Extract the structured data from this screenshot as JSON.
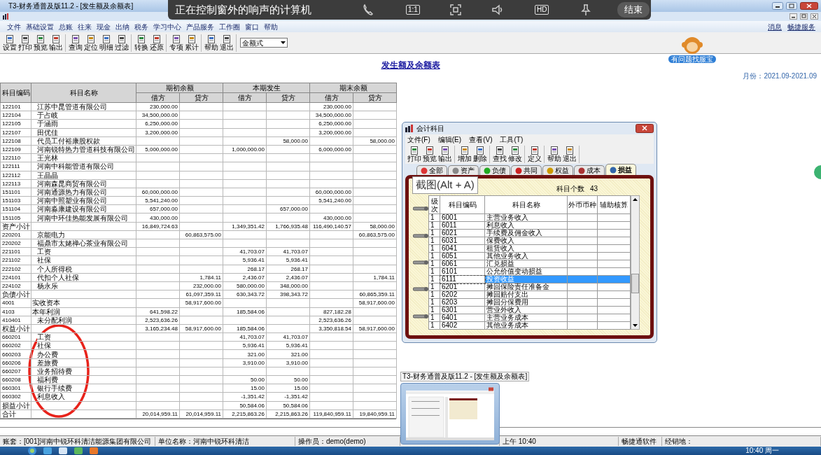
{
  "window": {
    "title": "T3-财务通普及版11.2 - [发生额及余额表]"
  },
  "share_bar": {
    "text": "正在控制窗外的响声的计算机",
    "ratio": "1:1",
    "quality": "HD",
    "end": "结束"
  },
  "menu": [
    "文件",
    "基础设置",
    "总账",
    "往来",
    "现金",
    "出纳",
    "税务",
    "学习中心",
    "产品服务",
    "工作圈",
    "窗口",
    "帮助"
  ],
  "menu_right": [
    "消息",
    "畅捷服务"
  ],
  "toolbar": [
    [
      "设置",
      "打印",
      "预览",
      "输出"
    ],
    [
      "查询",
      "定位",
      "明细",
      "过滤"
    ],
    [
      "转换",
      "还原"
    ],
    [
      "专项",
      "累计"
    ],
    [
      "帮助",
      "退出"
    ]
  ],
  "view_select": {
    "value": "金额式"
  },
  "helper": {
    "label": "有问题找服宝"
  },
  "report": {
    "title": "发生额及余额表",
    "period": "月份：2021.09-2021.09"
  },
  "table": {
    "columns": {
      "code": "科目编码",
      "name": "科目名称",
      "groups": [
        {
          "label": "期初余额",
          "debit": "借方",
          "credit": "贷方"
        },
        {
          "label": "本期发生",
          "debit": "借方",
          "credit": "贷方"
        },
        {
          "label": "期末余额",
          "debit": "借方",
          "credit": "贷方"
        }
      ]
    },
    "rows": [
      {
        "kind": "detail",
        "code": "122101",
        "name": "江苏中昆管道有限公司",
        "opening_debit": "230,000.00",
        "closing_debit": "230,000.00"
      },
      {
        "kind": "detail",
        "code": "122104",
        "name": "于占岐",
        "opening_debit": "34,500,000.00",
        "closing_debit": "34,500,000.00"
      },
      {
        "kind": "detail",
        "code": "122105",
        "name": "于涵雨",
        "opening_debit": "6,250,000.00",
        "closing_debit": "6,250,000.00"
      },
      {
        "kind": "detail",
        "code": "122107",
        "name": "田优佳",
        "opening_debit": "3,200,000.00",
        "closing_debit": "3,200,000.00"
      },
      {
        "kind": "detail",
        "code": "122108",
        "name": "代员工付裕康股权款",
        "period_credit": "58,000.00",
        "closing_credit": "58,000.00"
      },
      {
        "kind": "detail",
        "code": "122109",
        "name": "河南锐特热力管道科技有限公司",
        "opening_debit": "5,000,000.00",
        "period_debit": "1,000,000.00",
        "closing_debit": "6,000,000.00"
      },
      {
        "kind": "detail",
        "code": "122110",
        "name": "王光林"
      },
      {
        "kind": "detail",
        "code": "122111",
        "name": "河南中科能管道有限公司"
      },
      {
        "kind": "detail",
        "code": "122112",
        "name": "王晶晶"
      },
      {
        "kind": "detail",
        "code": "122113",
        "name": "河南森昆商贸有限公司"
      },
      {
        "kind": "detail",
        "code": "151101",
        "name": "河南通源热力有限公司",
        "opening_debit": "60,000,000.00",
        "closing_debit": "60,000,000.00"
      },
      {
        "kind": "detail",
        "code": "151103",
        "name": "河南中照塑业有限公司",
        "opening_debit": "5,541,240.00",
        "closing_debit": "5,541,240.00"
      },
      {
        "kind": "detail",
        "code": "151104",
        "name": "河南淼康建设有限公司",
        "opening_debit": "657,000.00",
        "period_credit": "657,000.00"
      },
      {
        "kind": "detail",
        "code": "151105",
        "name": "河南中环佳热能发展有限公司",
        "opening_debit": "430,000.00",
        "closing_debit": "430,000.00"
      },
      {
        "kind": "subtotal",
        "code": "资产小计",
        "opening_debit": "16,849,724.63",
        "period_debit": "1,349,351.42",
        "period_credit": "1,766,935.48",
        "closing_debit": "116,490,140.57",
        "closing_credit": "58,000.00"
      },
      {
        "kind": "detail",
        "code": "220201",
        "name": "京能电力",
        "opening_credit": "60,863,575.00",
        "closing_credit": "60,863,575.00"
      },
      {
        "kind": "detail",
        "code": "220202",
        "name": "福鼎市太姥禅心茶业有限公司"
      },
      {
        "kind": "detail",
        "code": "221101",
        "name": "工资",
        "period_debit": "41,703.07",
        "period_credit": "41,703.07"
      },
      {
        "kind": "detail",
        "code": "221102",
        "name": "社保",
        "period_debit": "5,936.41",
        "period_credit": "5,936.41"
      },
      {
        "kind": "detail",
        "code": "222102",
        "name": "个人所得税",
        "period_debit": "268.17",
        "period_credit": "268.17"
      },
      {
        "kind": "detail",
        "code": "224101",
        "name": "代扣个人社保",
        "opening_credit": "1,784.11",
        "period_debit": "2,436.07",
        "period_credit": "2,436.07",
        "closing_credit": "1,784.11"
      },
      {
        "kind": "detail",
        "code": "224102",
        "name": "杨永乐",
        "opening_credit": "232,000.00",
        "period_debit": "580,000.00",
        "period_credit": "348,000.00"
      },
      {
        "kind": "subtotal",
        "code": "负债小计",
        "opening_credit": "61,097,359.11",
        "period_debit": "630,343.72",
        "period_credit": "398,343.72",
        "closing_credit": "60,865,359.11"
      },
      {
        "kind": "account",
        "code": "4001",
        "name": "实收资本",
        "opening_credit": "58,917,600.00",
        "closing_credit": "58,917,600.00"
      },
      {
        "kind": "account",
        "code": "4103",
        "name": "本年利润",
        "opening_debit": "641,598.22",
        "period_debit": "185,584.06",
        "closing_debit": "827,182.28"
      },
      {
        "kind": "detail",
        "code": "410401",
        "name": "未分配利润",
        "opening_debit": "2,523,636.26",
        "closing_debit": "2,523,636.26"
      },
      {
        "kind": "subtotal",
        "code": "权益小计",
        "opening_debit": "3,165,234.48",
        "opening_credit": "58,917,600.00",
        "period_debit": "185,584.06",
        "closing_debit": "3,350,818.54",
        "closing_credit": "58,917,600.00"
      },
      {
        "kind": "detail",
        "code": "660201",
        "name": "工资",
        "period_debit": "41,703.07",
        "period_credit": "41,703.07"
      },
      {
        "kind": "detail",
        "code": "660202",
        "name": "社保",
        "period_debit": "5,936.41",
        "period_credit": "5,936.41"
      },
      {
        "kind": "detail",
        "code": "660203",
        "name": "办公费",
        "period_debit": "321.00",
        "period_credit": "321.00"
      },
      {
        "kind": "detail",
        "code": "660206",
        "name": "差旅费",
        "period_debit": "3,910.00",
        "period_credit": "3,910.00"
      },
      {
        "kind": "detail",
        "code": "660207",
        "name": "业务招待费"
      },
      {
        "kind": "detail",
        "code": "660208",
        "name": "福利费",
        "period_debit": "50.00",
        "period_credit": "50.00"
      },
      {
        "kind": "detail",
        "code": "660301",
        "name": "银行手续费",
        "period_debit": "15.00",
        "period_credit": "15.00"
      },
      {
        "kind": "detail",
        "code": "660302",
        "name": "利息收入",
        "period_debit": "-1,351.42",
        "period_credit": "-1,351.42"
      },
      {
        "kind": "subtotal",
        "code": "损益小计",
        "period_debit": "50,584.06",
        "period_credit": "50,584.06"
      },
      {
        "kind": "total",
        "code": "合计",
        "opening_debit": "20,014,959.11",
        "opening_credit": "20,014,959.11",
        "period_debit": "2,215,863.26",
        "period_credit": "2,215,863.26",
        "closing_debit": "119,840,959.11",
        "closing_credit": "19,840,959.11"
      }
    ]
  },
  "dialog": {
    "title": "会计科目",
    "menu": [
      "文件(F)",
      "编辑(E)",
      "查看(V)",
      "工具(T)"
    ],
    "toolbar": [
      [
        "打印",
        "预览",
        "输出"
      ],
      [
        "增加",
        "删除"
      ],
      [
        "查找",
        "修改"
      ],
      [
        "定义"
      ],
      [
        "帮助",
        "退出"
      ]
    ],
    "tabs": [
      {
        "label": "全部",
        "selected": false
      },
      {
        "label": "资产",
        "selected": false
      },
      {
        "label": "负债",
        "selected": false
      },
      {
        "label": "共同",
        "selected": false
      },
      {
        "label": "权益",
        "selected": false
      },
      {
        "label": "成本",
        "selected": false
      },
      {
        "label": "损益",
        "selected": true
      }
    ],
    "count_label": "科目个数",
    "count": "43",
    "columns": [
      "级次",
      "科目编码",
      "科目名称",
      "外币币种",
      "辅助核算"
    ],
    "rows": [
      {
        "level": "1",
        "code": "6001",
        "name": "主营业务收入",
        "selected": false
      },
      {
        "level": "1",
        "code": "6011",
        "name": "利息收入",
        "selected": false
      },
      {
        "level": "1",
        "code": "6021",
        "name": "手续费及佣金收入",
        "selected": false
      },
      {
        "level": "1",
        "code": "6031",
        "name": "保费收入",
        "selected": false
      },
      {
        "level": "1",
        "code": "6041",
        "name": "租赁收入",
        "selected": false
      },
      {
        "level": "1",
        "code": "6051",
        "name": "其他业务收入",
        "selected": false
      },
      {
        "level": "1",
        "code": "6061",
        "name": "汇兑损益",
        "selected": false
      },
      {
        "level": "1",
        "code": "6101",
        "name": "公允价值变动损益",
        "selected": false
      },
      {
        "level": "1",
        "code": "6111",
        "name": "投资收益",
        "selected": true
      },
      {
        "level": "1",
        "code": "6201",
        "name": "摊回保险责任准备金",
        "selected": false
      },
      {
        "level": "1",
        "code": "6202",
        "name": "摊回赔付支出",
        "selected": false
      },
      {
        "level": "1",
        "code": "6203",
        "name": "摊回分保费用",
        "selected": false
      },
      {
        "level": "1",
        "code": "6301",
        "name": "营业外收入",
        "selected": false
      },
      {
        "level": "1",
        "code": "6401",
        "name": "主营业务成本",
        "selected": false
      },
      {
        "level": "1",
        "code": "6402",
        "name": "其他业务成本",
        "selected": false
      }
    ]
  },
  "tooltip": {
    "text": "截图(Alt + A)"
  },
  "thumbnail": {
    "title": "T3-财务通普及版11.2 - [发生额及余额表]"
  },
  "status_bar": [
    "账套：[001]河南中锐环科清洁能源集团有限公司",
    "单位名称：河南中锐环科清洁",
    "操作员：demo(demo)",
    "上午 10:40",
    "畅捷通软件",
    "经销地："
  ],
  "taskbar": {
    "clock": "10:40 周一"
  }
}
